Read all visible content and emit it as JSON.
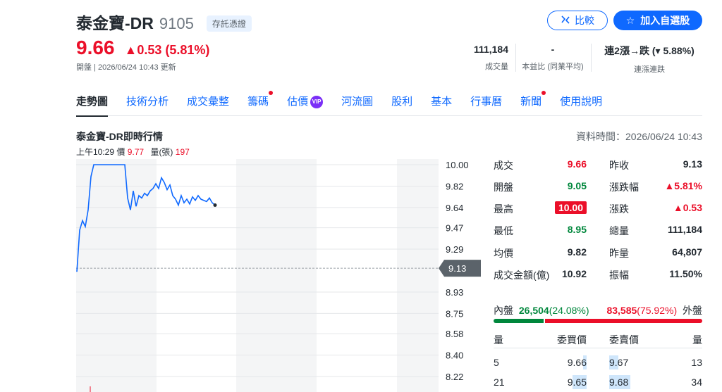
{
  "header": {
    "name": "泰金寶-DR",
    "code": "9105",
    "tag": "存託憑證",
    "compare_label": "比較",
    "add_label": "加入自選股",
    "price": "9.66",
    "change": "0.53 (5.81%)",
    "meta": "開盤 | 2026/06/24 10:43 更新",
    "stats": [
      {
        "value": "111,184",
        "label": "成交量"
      },
      {
        "value": "-",
        "label": "本益比 (同業平均)"
      },
      {
        "value": "連2漲→跌 (▾ 5.88%)",
        "label": "連漲連跌"
      }
    ]
  },
  "tabs": [
    {
      "label": "走勢圖",
      "active": true
    },
    {
      "label": "技術分析"
    },
    {
      "label": "成交彙整"
    },
    {
      "label": "籌碼",
      "dot": true
    },
    {
      "label": "估價",
      "vip": "VIP"
    },
    {
      "label": "河流圖"
    },
    {
      "label": "股利"
    },
    {
      "label": "基本"
    },
    {
      "label": "行事曆"
    },
    {
      "label": "新聞",
      "dot": true
    },
    {
      "label": "使用說明"
    }
  ],
  "section": {
    "title": "泰金寶-DR即時行情",
    "data_time": "資料時間：2026/06/24 10:43",
    "hover_time": "上午10:29",
    "hover_price_label": "價",
    "hover_price": "9.77",
    "hover_vol_label": "量(張)",
    "hover_vol": "197"
  },
  "chart_data": {
    "type": "line",
    "y_ticks": [
      "10.00",
      "9.82",
      "9.64",
      "9.47",
      "9.29",
      "9.13",
      "8.93",
      "8.75",
      "8.58",
      "8.40",
      "8.22"
    ],
    "ylim": [
      8.22,
      10.0
    ],
    "reference_label": "9.13",
    "reference": 9.13,
    "series": [
      {
        "values": [
          9.1,
          9.45,
          9.53,
          9.48,
          9.62,
          9.9,
          10.0,
          10.0,
          10.0,
          10.0,
          10.0,
          10.0,
          10.0,
          10.0,
          10.0,
          10.0,
          10.0,
          10.0,
          9.72,
          9.62,
          9.78,
          9.65,
          9.74,
          9.72,
          9.76,
          9.74,
          9.78,
          9.8,
          9.84,
          9.8,
          9.89,
          9.85,
          9.79,
          9.83,
          9.74,
          9.71,
          9.66,
          9.74,
          9.68,
          9.71,
          9.67,
          9.73,
          9.7,
          9.74,
          9.71,
          9.7,
          9.69,
          9.72,
          9.68,
          9.66
        ]
      }
    ]
  },
  "quote": {
    "left": [
      {
        "label": "成交",
        "value": "9.66",
        "color": "red"
      },
      {
        "label": "開盤",
        "value": "9.05",
        "color": "green"
      },
      {
        "label": "最高",
        "value": "10.00",
        "color": "box"
      },
      {
        "label": "最低",
        "value": "8.95",
        "color": "green"
      },
      {
        "label": "均價",
        "value": "9.82",
        "color": "normal"
      },
      {
        "label": "成交金額(億)",
        "value": "10.92",
        "color": "normal"
      }
    ],
    "right": [
      {
        "label": "昨收",
        "value": "9.13",
        "color": "normal"
      },
      {
        "label": "漲跌幅",
        "value": "▲5.81%",
        "color": "red"
      },
      {
        "label": "漲跌",
        "value": "▲0.53",
        "color": "red"
      },
      {
        "label": "總量",
        "value": "111,184",
        "color": "normal"
      },
      {
        "label": "昨量",
        "value": "64,807",
        "color": "normal"
      },
      {
        "label": "振幅",
        "value": "11.50%",
        "color": "normal"
      }
    ],
    "inner_label": "內盤",
    "inner_value": "26,504",
    "inner_pct": "(24.08%)",
    "outer_value": "83,585",
    "outer_pct": "(75.92%)",
    "outer_label": "外盤",
    "inner_ratio": 0.2408,
    "book_headers": [
      "量",
      "委買價",
      "委賣價",
      "量"
    ],
    "book": [
      {
        "bid_vol": "5",
        "bid": "9.66",
        "ask": "9.67",
        "ask_vol": "13",
        "bid_fill": 0.1,
        "ask_fill": 0.25
      },
      {
        "bid_vol": "21",
        "bid": "9.65",
        "ask": "9.68",
        "ask_vol": "34",
        "bid_fill": 0.4,
        "ask_fill": 0.6
      }
    ]
  }
}
